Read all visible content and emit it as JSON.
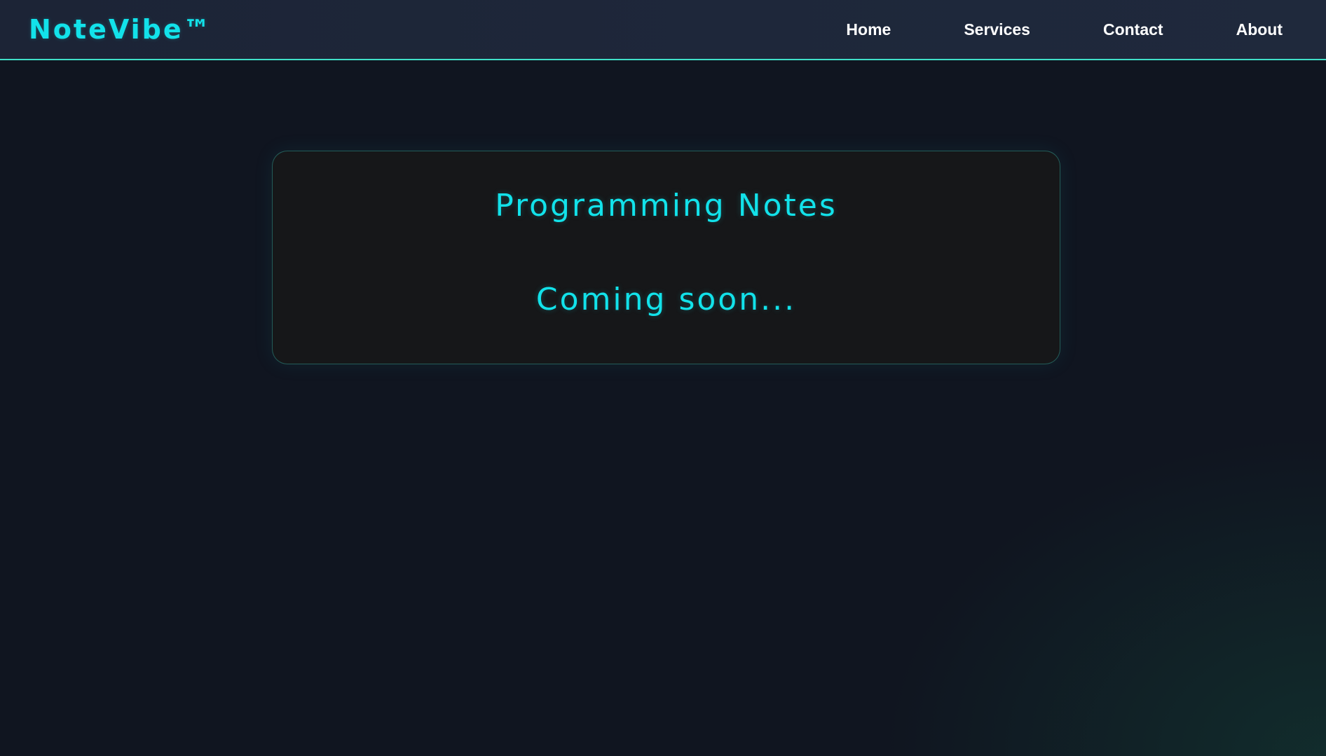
{
  "brand": {
    "name": "NoteVibe™",
    "accent_color": "#12e2ea"
  },
  "nav": {
    "items": [
      {
        "label": "Home"
      },
      {
        "label": "Services"
      },
      {
        "label": "Contact"
      },
      {
        "label": "About"
      }
    ]
  },
  "main": {
    "card": {
      "title": "Programming Notes",
      "message": "Coming soon..."
    }
  },
  "colors": {
    "background": "#101520",
    "navbar": "#1e273a",
    "navbar_border": "#3fe0c8",
    "card": "#161719",
    "text_accent": "#12e2ea",
    "nav_text": "#ffffff"
  }
}
